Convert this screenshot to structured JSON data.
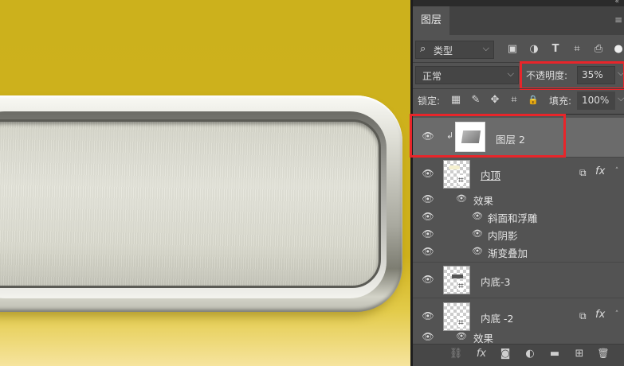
{
  "panel": {
    "tab_label": "图层",
    "menu_icon": "≡",
    "collapse_icon": "«"
  },
  "filter": {
    "kind_label": "类型",
    "search_icon": "⌕",
    "dropdown_icon": "⌵",
    "icons": [
      "image-filter-icon",
      "adjustment-filter-icon",
      "type-filter-icon",
      "shape-filter-icon",
      "smart-object-filter-icon"
    ],
    "icon_glyphs": [
      "▣",
      "◑",
      "T",
      "⌗",
      "⎙"
    ]
  },
  "blend": {
    "mode": "正常",
    "opacity_label": "不透明度:",
    "opacity_value": "35%"
  },
  "lock": {
    "label": "锁定:",
    "icon_glyphs": [
      "▦",
      "✎",
      "✥",
      "⌗",
      "🔒"
    ],
    "fill_label": "填充:",
    "fill_value": "100%"
  },
  "layers": [
    {
      "name": "图层 2",
      "selected": true,
      "clipped": true
    },
    {
      "name": "内顶",
      "fx": "fx",
      "effects_label": "效果",
      "effects": [
        "斜面和浮雕",
        "内阴影",
        "渐变叠加"
      ]
    },
    {
      "name": "内底-3"
    },
    {
      "name": "内底 -2",
      "fx": "fx",
      "effects_label": "效果"
    }
  ],
  "bottom_icons": [
    "link-layers-icon",
    "fx-icon",
    "add-mask-icon",
    "adjustment-layer-icon",
    "new-group-icon",
    "new-layer-icon",
    "trash-icon"
  ],
  "bottom_glyphs": [
    "⛓",
    "fx",
    "◙",
    "◐",
    "▬",
    "⊞",
    "🗑"
  ],
  "colors": {
    "canvas_bg": "#cdb21c",
    "panel_bg": "#535353",
    "highlight_red": "#e8252a"
  }
}
